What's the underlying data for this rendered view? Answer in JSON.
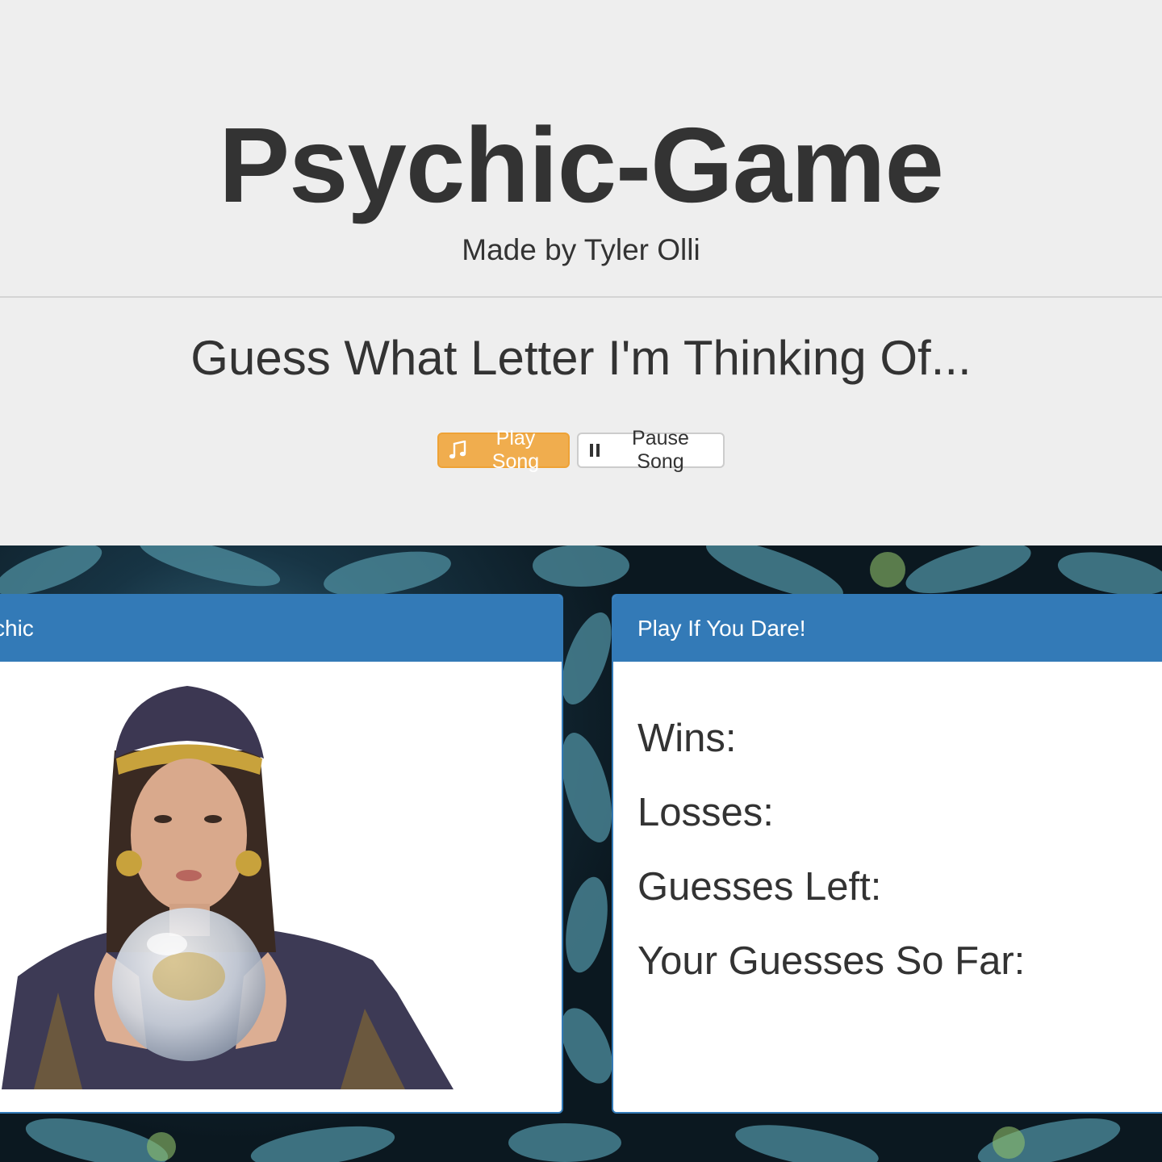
{
  "header": {
    "title": "Psychic-Game",
    "subtitle": "Made by Tyler Olli",
    "prompt": "Guess What Letter I'm Thinking Of..."
  },
  "controls": {
    "play_label": "Play Song",
    "play_icon": "music-note-icon",
    "pause_label": "Pause Song",
    "pause_icon": "pause-icon"
  },
  "panels": {
    "left_title": "ychic",
    "right_title": "Play If You Dare!"
  },
  "stats": {
    "wins_label": "Wins:",
    "losses_label": "Losses:",
    "guesses_left_label": "Guesses Left:",
    "guesses_so_far_label": "Your Guesses So Far:"
  },
  "colors": {
    "jumbotron_bg": "#eeeeee",
    "panel_primary": "#337ab7",
    "warning_button": "#f0ad4e"
  }
}
